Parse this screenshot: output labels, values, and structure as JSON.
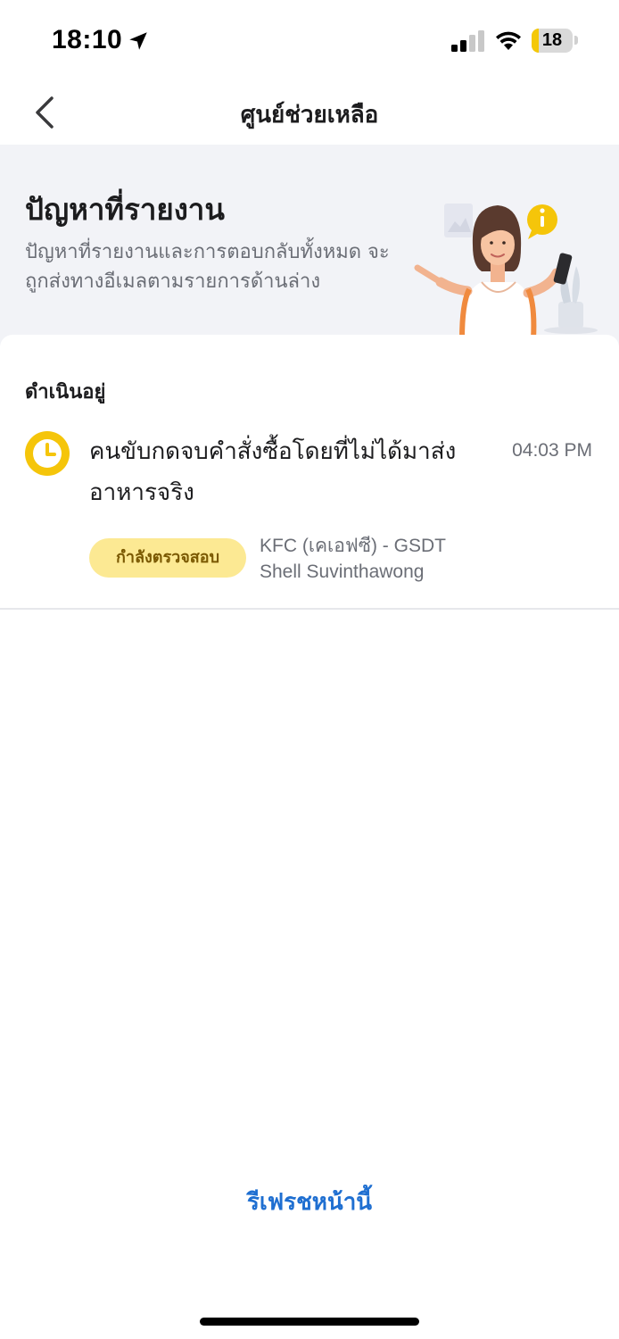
{
  "status_bar": {
    "time": "18:10",
    "battery": "18",
    "battery_level_percent": 18,
    "icons": [
      "location-arrow-icon",
      "cellular-signal-icon",
      "wifi-icon",
      "battery-icon"
    ]
  },
  "nav": {
    "title": "ศูนย์ช่วยเหลือ",
    "back_icon": "chevron-left-icon"
  },
  "banner": {
    "title": "ปัญหาที่รายงาน",
    "description": "ปัญหาที่รายงานและการตอบกลับทั้งหมด จะถูกส่งทางอีเมลตามรายการด้านล่าง"
  },
  "section": {
    "label": "ดำเนินอยู่"
  },
  "tickets": [
    {
      "title": "คนขับกดจบคำสั่งซื้อโดยที่ไม่ได้มาส่งอาหารจริง",
      "time": "04:03 PM",
      "status": "กำลังตรวจสอบ",
      "store_name": "KFC (เคเอฟซี) - GSDT",
      "store_branch": "Shell Suvinthawong",
      "icon": "clock-icon"
    }
  ],
  "refresh": {
    "label": "รีเฟรชหน้านี้"
  },
  "colors": {
    "accent_blue": "#1f6fd1",
    "badge_bg": "#fce993",
    "clock_yellow": "#f5c50a",
    "banner_bg": "#f2f3f7"
  }
}
